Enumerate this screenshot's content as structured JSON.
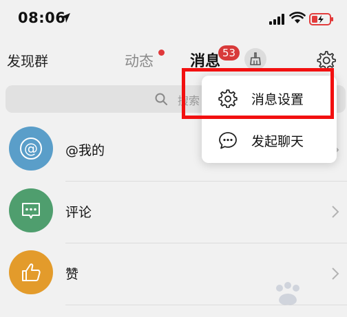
{
  "status_bar": {
    "time": "08:06"
  },
  "header": {
    "tab_discover": "发现群",
    "tab_dongtai": "动态",
    "tab_messages": "消息",
    "messages_badge": "53"
  },
  "search": {
    "placeholder": "搜索"
  },
  "list": {
    "items": [
      {
        "label": "@我的",
        "icon": "at-icon",
        "color": "#5a9ec9"
      },
      {
        "label": "评论",
        "icon": "comment-icon",
        "color": "#4f9e6e"
      },
      {
        "label": "赞",
        "icon": "thumbs-up-icon",
        "color": "#e39b2b"
      }
    ]
  },
  "popup": {
    "items": [
      {
        "label": "消息设置",
        "icon": "gear-icon"
      },
      {
        "label": "发起聊天",
        "icon": "chat-bubble-icon"
      }
    ]
  },
  "colors": {
    "accent_red": "#d83a3a",
    "highlight_red": "#f21010"
  }
}
